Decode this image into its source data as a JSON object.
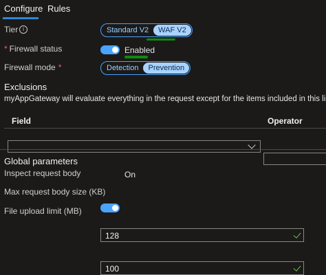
{
  "tabs": [
    {
      "label": "Configure"
    },
    {
      "label": "Rules"
    }
  ],
  "tier": {
    "label": "Tier",
    "options": [
      "Standard V2",
      "WAF V2"
    ],
    "selected": "WAF V2"
  },
  "firewall_status": {
    "label": "Firewall status",
    "value": "Enabled"
  },
  "firewall_mode": {
    "label": "Firewall mode",
    "options": [
      "Detection",
      "Prevention"
    ],
    "selected": "Prevention"
  },
  "exclusions": {
    "title": "Exclusions",
    "description": "myAppGateway will evaluate everything in the request except for the items included in this list.",
    "columns": [
      "Field",
      "Operator"
    ]
  },
  "global_parameters": {
    "title": "Global parameters",
    "inspect_body": {
      "label": "Inspect request body",
      "value": "On"
    },
    "max_body_size": {
      "label": "Max request body size (KB)",
      "value": "128"
    },
    "file_upload_limit": {
      "label": "File upload limit (MB)",
      "value": "100"
    }
  },
  "colors": {
    "accent": "#4aa3ff",
    "highlight_marks": "#0c8a12",
    "valid_check": "#6cc04a"
  }
}
